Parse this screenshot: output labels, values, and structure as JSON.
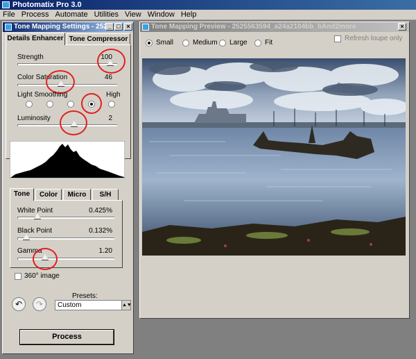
{
  "app": {
    "title": "Photomatix Pro 3.0",
    "menu": [
      "File",
      "Process",
      "Automate",
      "Utilities",
      "View",
      "Window",
      "Help"
    ]
  },
  "settings_window": {
    "title": "Tone Mapping Settings - 2525...",
    "tabs": [
      "Details Enhancer",
      "Tone Compressor"
    ],
    "active_tab": 0,
    "sliders": {
      "strength": {
        "label": "Strength",
        "value": "100",
        "level": 1.0
      },
      "color_saturation": {
        "label": "Color Saturation",
        "value": "46",
        "level": 0.46
      },
      "luminosity": {
        "label": "Luminosity",
        "value": "2",
        "level": 0.6
      }
    },
    "light_smoothing": {
      "label": "Light Smoothing",
      "high_label": "High",
      "options": 5,
      "selected": 4
    },
    "sub_tabs": [
      "Tone",
      "Color",
      "Micro",
      "S/H"
    ],
    "active_sub_tab": 0,
    "tone": {
      "white_point": {
        "label": "White Point",
        "value": "0.425%",
        "level": 0.22
      },
      "black_point": {
        "label": "Black Point",
        "value": "0.132%",
        "level": 0.08
      },
      "gamma": {
        "label": "Gamma",
        "value": "1.20",
        "level": 0.3
      }
    },
    "image_360": {
      "label": "360° image",
      "checked": false
    },
    "presets": {
      "label": "Presets:",
      "value": "Custom"
    },
    "process_button": "Process",
    "undo_icon": "undo-arrow-icon",
    "redo_icon": "redo-arrow-icon"
  },
  "preview_window": {
    "title": "Tone Mapping Preview - 2525563594_a24a2104bb_bAnd2more",
    "size_options": [
      "Small",
      "Medium",
      "Large",
      "Fit"
    ],
    "selected_size": 0,
    "refresh_loupe": {
      "label": "Refresh loupe only",
      "checked": false
    }
  },
  "colors": {
    "title_active": "#0a246a",
    "panel_bg": "#d4d0c8",
    "annotation": "#e02020",
    "workspace": "#808080"
  }
}
